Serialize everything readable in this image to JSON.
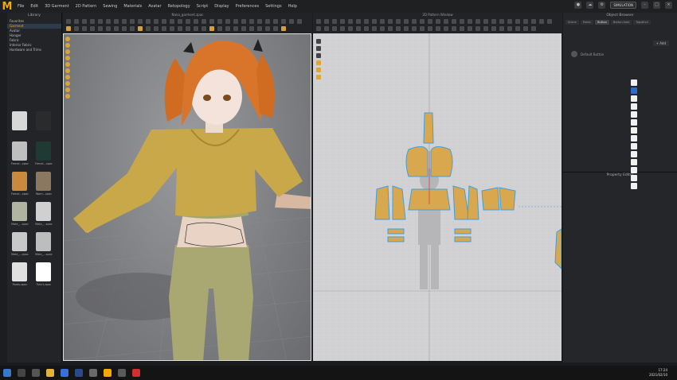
{
  "app": {
    "logo_letter": "M",
    "window_3d_title": "Nana_garment.zpac",
    "window_2d_title": "2D Pattern Window"
  },
  "menu": [
    "File",
    "Edit",
    "3D Garment",
    "2D Pattern",
    "Sewing",
    "Materials",
    "Avatar",
    "Retopology",
    "Script",
    "Display",
    "Preferences",
    "Settings",
    "Help"
  ],
  "top_right": {
    "simulation_label": "SIMULATION"
  },
  "library": {
    "title": "Library",
    "tree": [
      "Favorites",
      "Garment",
      "Avatar",
      "Hanger",
      "Fabric",
      "Interior Fabric",
      "Hardware and Trims"
    ],
    "active_index": 1,
    "thumbs": [
      {
        "label": "",
        "color": "#d8d8d8"
      },
      {
        "label": "",
        "color": "#2a2b2d"
      },
      {
        "label": "Femal...zpac",
        "color": "#bfbfbf"
      },
      {
        "label": "Femal...zpac",
        "color": "#1f3a32"
      },
      {
        "label": "Femal...zpac",
        "color": "#c98a3e"
      },
      {
        "label": "Wom...zpac",
        "color": "#8a7860"
      },
      {
        "label": "Male_...zpac",
        "color": "#b0b4a0"
      },
      {
        "label": "Male_...zpac",
        "color": "#d0d0d0"
      },
      {
        "label": "Male_...zpac",
        "color": "#c8c8c8"
      },
      {
        "label": "Male_...zpac",
        "color": "#bdbdbd"
      },
      {
        "label": "Pants.zpac",
        "color": "#e0e0e0"
      },
      {
        "label": "Tshirt.zpac",
        "color": "#ffffff"
      }
    ]
  },
  "object_browser": {
    "title": "Object Browser",
    "tabs": [
      "Scene",
      "Fabric",
      "Button",
      "Button-hole",
      "Topstitch"
    ],
    "active_tab": 2,
    "add_label": "+ Add",
    "fabric_item": "Default Button"
  },
  "property_editor": {
    "title": "Property Editor"
  },
  "clock": {
    "time": "17:24",
    "date": "2021/02/10"
  },
  "colors": {
    "accent": "#f2a900",
    "pattern_fill": "#d9a84e",
    "pattern_stroke": "#3da0e0",
    "hoodie": "#c9a84a",
    "pants": "#a9a873",
    "hair": "#d9752a"
  }
}
